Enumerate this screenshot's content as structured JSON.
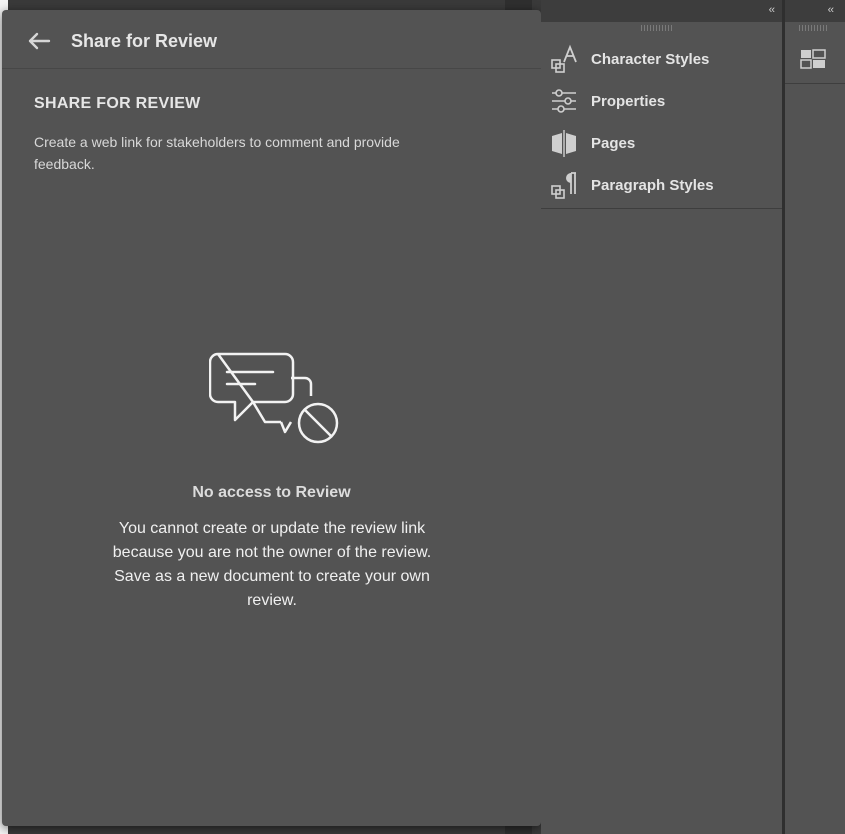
{
  "popover": {
    "header_title": "Share for Review",
    "section_title": "SHARE FOR REVIEW",
    "section_description": "Create a web link for stakeholders to comment and provide feedback.",
    "empty_state": {
      "title": "No access to Review",
      "message": "You cannot create or update the review link because you are not the owner of the review. Save as a new document to create your own review."
    }
  },
  "panel_dock": {
    "collapse_label": "‹‹",
    "items": [
      {
        "label": "Character Styles",
        "icon": "character-styles-icon"
      },
      {
        "label": "Properties",
        "icon": "properties-icon"
      },
      {
        "label": "Pages",
        "icon": "pages-icon"
      },
      {
        "label": "Paragraph Styles",
        "icon": "paragraph-styles-icon"
      }
    ]
  },
  "mini_dock": {
    "collapse_label": "‹‹",
    "icon": "panel-grid-icon"
  }
}
